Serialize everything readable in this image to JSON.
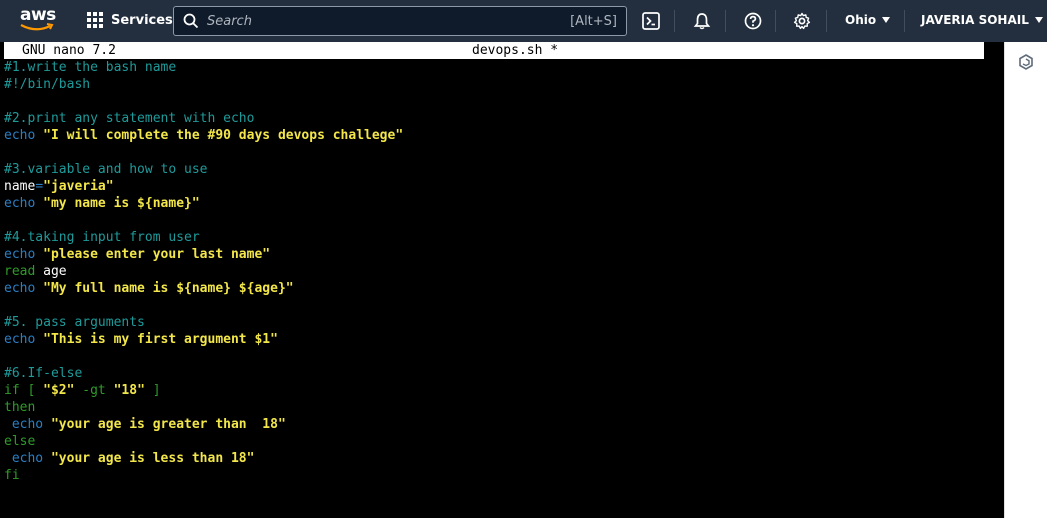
{
  "nav": {
    "logo_text": "aws",
    "services_label": "Services",
    "search_placeholder": "Search",
    "search_shortcut": "[Alt+S]",
    "region": "Ohio",
    "user": "JAVERIA SOHAIL",
    "icons": [
      "cloudshell-icon",
      "bell-icon",
      "help-icon",
      "gear-icon"
    ]
  },
  "editor": {
    "title": "GNU nano 7.2",
    "filename": "devops.sh *"
  },
  "code": [
    [
      {
        "t": "#1.write the bash name",
        "c": "cm"
      }
    ],
    [
      {
        "t": "#!/bin/bash",
        "c": "cm"
      }
    ],
    [],
    [
      {
        "t": "#2.print any statement with echo",
        "c": "cm"
      }
    ],
    [
      {
        "t": "echo ",
        "c": "kw"
      },
      {
        "t": "\"I will complete the #90 days devops challege\"",
        "c": "str"
      }
    ],
    [],
    [
      {
        "t": "#3.variable and how to use",
        "c": "cm"
      }
    ],
    [
      {
        "t": "name",
        "c": "plain"
      },
      {
        "t": "=",
        "c": "kw"
      },
      {
        "t": "\"javeria\"",
        "c": "str"
      }
    ],
    [
      {
        "t": "echo ",
        "c": "kw"
      },
      {
        "t": "\"my name is ${name}\"",
        "c": "str"
      }
    ],
    [],
    [
      {
        "t": "#4.taking input from user",
        "c": "cm"
      }
    ],
    [
      {
        "t": "echo ",
        "c": "kw"
      },
      {
        "t": "\"please enter your last name\"",
        "c": "str"
      }
    ],
    [
      {
        "t": "read ",
        "c": "ctl"
      },
      {
        "t": "age",
        "c": "plain"
      }
    ],
    [
      {
        "t": "echo ",
        "c": "kw"
      },
      {
        "t": "\"My full name is ${name} ${age}\"",
        "c": "str"
      }
    ],
    [],
    [
      {
        "t": "#5. pass arguments",
        "c": "cm"
      }
    ],
    [
      {
        "t": "echo ",
        "c": "kw"
      },
      {
        "t": "\"This is my first argument $1\"",
        "c": "str"
      }
    ],
    [],
    [
      {
        "t": "#6.If-else",
        "c": "cm"
      }
    ],
    [
      {
        "t": "if [ ",
        "c": "ctl"
      },
      {
        "t": "\"$2\"",
        "c": "str"
      },
      {
        "t": " -gt ",
        "c": "ctl"
      },
      {
        "t": "\"18\"",
        "c": "str"
      },
      {
        "t": " ]",
        "c": "ctl"
      }
    ],
    [
      {
        "t": "then",
        "c": "ctl"
      }
    ],
    [
      {
        "t": " echo ",
        "c": "kw"
      },
      {
        "t": "\"your age is greater than  18\"",
        "c": "str"
      }
    ],
    [
      {
        "t": "else",
        "c": "ctl"
      }
    ],
    [
      {
        "t": " echo ",
        "c": "kw"
      },
      {
        "t": "\"your age is less than 18\"",
        "c": "str"
      }
    ],
    [
      {
        "t": "fi",
        "c": "ctl"
      }
    ]
  ]
}
